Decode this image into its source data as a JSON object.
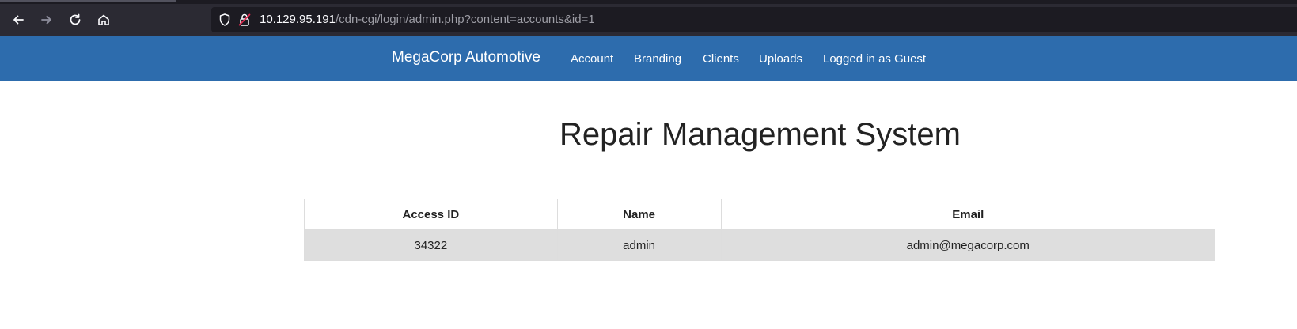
{
  "browser": {
    "url_host": "10.129.95.191",
    "url_path": "/cdn-cgi/login/admin.php?content=accounts&id=1",
    "back_icon": "arrow-left-icon",
    "forward_icon": "arrow-right-icon",
    "reload_icon": "reload-icon",
    "home_icon": "home-icon",
    "shield_icon": "shield-icon",
    "insecure_icon": "insecure-lock-icon"
  },
  "navbar": {
    "brand": "MegaCorp Automotive",
    "links": [
      "Account",
      "Branding",
      "Clients",
      "Uploads",
      "Logged in as Guest"
    ],
    "background": "#2d6cad"
  },
  "main": {
    "title": "Repair Management System",
    "table": {
      "headers": [
        "Access ID",
        "Name",
        "Email"
      ],
      "rows": [
        [
          "34322",
          "admin",
          "admin@megacorp.com"
        ]
      ],
      "row_background": "#dedede"
    }
  }
}
